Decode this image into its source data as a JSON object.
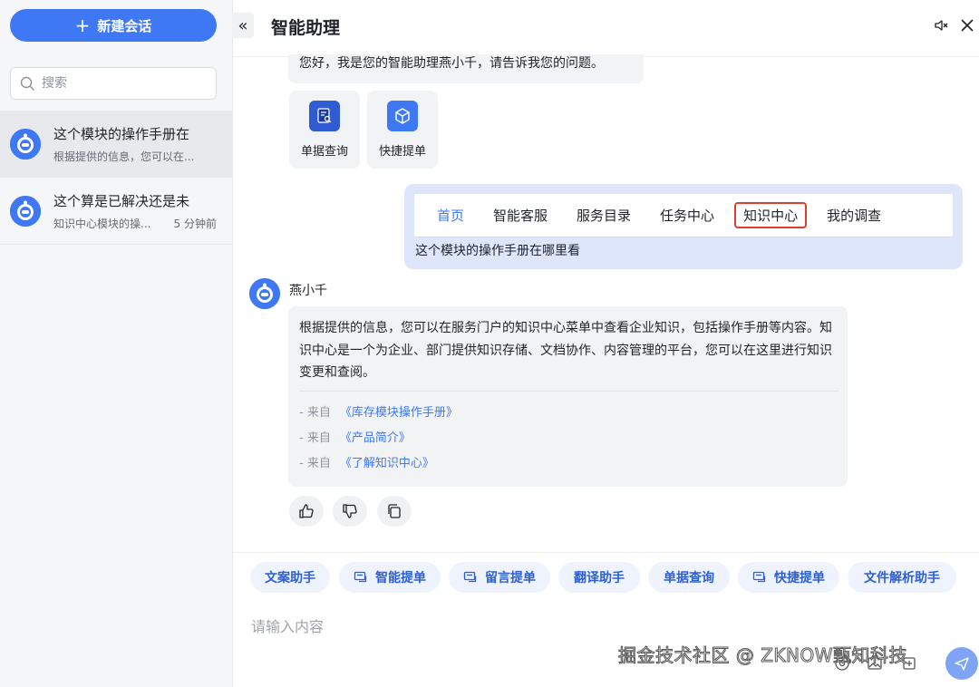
{
  "sidebar": {
    "new_chat_label": "新建会话",
    "search_placeholder": "搜索",
    "conversations": [
      {
        "title": "这个模块的操作手册在",
        "preview": "根据提供的信息，您可以在...",
        "time": ""
      },
      {
        "title": "这个算是已解决还是未",
        "preview": "知识中心模块的操...",
        "time": "5 分钟前"
      }
    ]
  },
  "header": {
    "title": "智能助理"
  },
  "chat": {
    "greeting": "您好，我是您的智能助理燕小千，请告诉我您的问题。",
    "quick_cards": [
      {
        "label": "单据查询",
        "icon": "document-search-icon"
      },
      {
        "label": "快捷提单",
        "icon": "cube-icon"
      }
    ],
    "user_message": {
      "nav_items": [
        "首页",
        "智能客服",
        "服务目录",
        "任务中心",
        "知识中心",
        "我的调查"
      ],
      "text": "这个模块的操作手册在哪里看"
    },
    "bot": {
      "name": "燕小千",
      "reply": "根据提供的信息，您可以在服务门户的知识中心菜单中查看企业知识，包括操作手册等内容。知识中心是一个为企业、部门提供知识存储、文档协作、内容管理的平台，您可以在这里进行知识变更和查阅。",
      "sources": [
        {
          "prefix": "- 来自",
          "link": "《库存模块操作手册》"
        },
        {
          "prefix": "- 来自",
          "link": "《产品简介》"
        },
        {
          "prefix": "- 来自",
          "link": "《了解知识中心》"
        }
      ]
    }
  },
  "tools": [
    {
      "label": "文案助手",
      "icon": ""
    },
    {
      "label": "智能提单",
      "icon": "ticket-icon"
    },
    {
      "label": "留言提单",
      "icon": "ticket-icon"
    },
    {
      "label": "翻译助手",
      "icon": ""
    },
    {
      "label": "单据查询",
      "icon": ""
    },
    {
      "label": "快捷提单",
      "icon": "ticket-icon"
    },
    {
      "label": "文件解析助手",
      "icon": ""
    }
  ],
  "input": {
    "placeholder": "请输入内容"
  },
  "watermark": "掘金技术社区 @ ZKNOW甄知科技",
  "colors": {
    "accent": "#3f78f5",
    "highlight_border": "#d9412e",
    "user_bubble": "#dde6fb"
  }
}
